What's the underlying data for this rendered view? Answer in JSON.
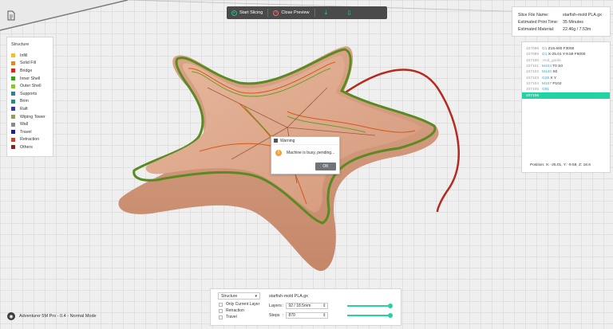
{
  "toolbar": {
    "start_slicing": "Start Slicing",
    "close_preview": "Close Preview"
  },
  "legend": {
    "title": "Structure",
    "items": [
      {
        "label": "Infill",
        "color": "#f2c21b"
      },
      {
        "label": "Solid Fill",
        "color": "#e58a19"
      },
      {
        "label": "Bridge",
        "color": "#d6291b"
      },
      {
        "label": "Inner Shell",
        "color": "#3a9d1e"
      },
      {
        "label": "Outer Shell",
        "color": "#88c43a"
      },
      {
        "label": "Supports",
        "color": "#2c7ea6"
      },
      {
        "label": "Brim",
        "color": "#1e8f8a"
      },
      {
        "label": "Raft",
        "color": "#3b3b9f"
      },
      {
        "label": "Wiping Tower",
        "color": "#9b9761"
      },
      {
        "label": "Wall",
        "color": "#8a8a8a"
      },
      {
        "label": "Travel",
        "color": "#1c1c9e"
      },
      {
        "label": "Retraction",
        "color": "#d73b1f"
      },
      {
        "label": "Others",
        "color": "#7b2a2a"
      }
    ]
  },
  "info": {
    "file_label": "Slice File Name:",
    "file_value": "starfish-mold PLA.gx",
    "time_label": "Estimated Print Time:",
    "time_value": "35 Minutes",
    "material_label": "Estimated Material:",
    "material_value": "22.46g / 7.53m"
  },
  "gcode": {
    "lines": [
      {
        "num": "107098",
        "kw": "G1",
        "rest": " Z18.600 F3000"
      },
      {
        "num": "107099",
        "kw": "G1",
        "rest": " X-25.01 Y-9.59 F6000"
      },
      {
        "num": "107100",
        "kw": "",
        "rest": ";end_guide",
        "comment": true
      },
      {
        "num": "107101",
        "kw": "M104",
        "rest": " T0 S0"
      },
      {
        "num": "107102",
        "kw": "M140",
        "rest": " S0"
      },
      {
        "num": "107103",
        "kw": "G28",
        "rest": " X Y"
      },
      {
        "num": "107104",
        "kw": "M107",
        "rest": " P102"
      },
      {
        "num": "107105",
        "kw": "G91",
        "rest": ""
      },
      {
        "num": "107106",
        "kw": "",
        "rest": "",
        "selected": true
      }
    ],
    "position": "Position:   X: -25.01, Y: -9.59, Z: 18.6"
  },
  "warning": {
    "title": "Warning",
    "message": "Machine is busy, pending...",
    "ok": "OK"
  },
  "bottom": {
    "structure_value": "Structure",
    "checkboxes": [
      "Only Current Layer",
      "Retraction",
      "Travel"
    ],
    "file_name": "starfish-mold PLA.gx",
    "layers_label": "Layers",
    "layers_value": "92 / 18.5mm",
    "layers_progress": 1.0,
    "steps_label": "Steps",
    "steps_value": "870",
    "steps_progress": 1.0
  },
  "status": {
    "text": "Adventurer 5M Pro - 0.4 - Normal Mode"
  }
}
